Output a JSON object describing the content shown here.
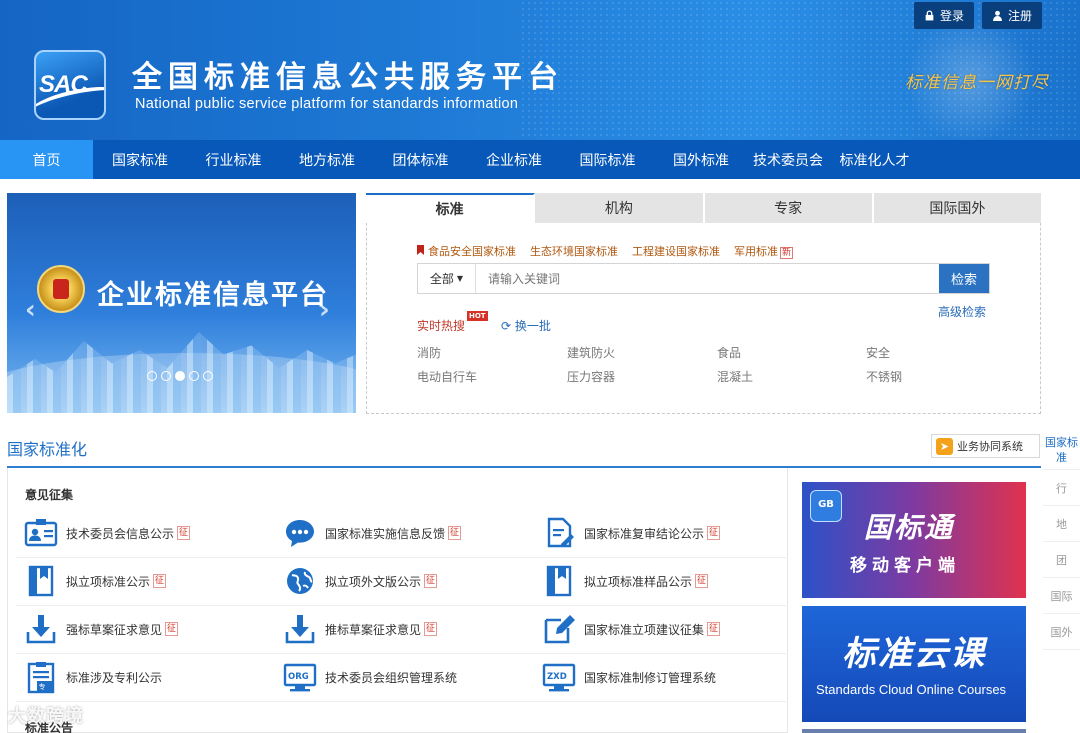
{
  "auth": {
    "login": "登录",
    "register": "注册"
  },
  "header": {
    "logo_text": "SAC",
    "title_cn": "全国标准信息公共服务平台",
    "title_en": "National public service platform  for standards information",
    "slogan": "标准信息一网打尽"
  },
  "nav": [
    "首页",
    "国家标准",
    "行业标准",
    "地方标准",
    "团体标准",
    "企业标准",
    "国际标准",
    "国外标准",
    "技术委员会",
    "标准化人才"
  ],
  "banner": {
    "title": "企业标准信息平台",
    "slides": 5,
    "active_slide": 3
  },
  "search": {
    "tabs": [
      "标准",
      "机构",
      "专家",
      "国际国外"
    ],
    "quick_links": [
      "食品安全国家标准",
      "生态环境国家标准",
      "工程建设国家标准",
      "军用标准"
    ],
    "new_badge": "新",
    "scope": "全部",
    "placeholder": "请输入关键词",
    "button": "检索",
    "advanced": "高级检索",
    "hot_label": "实时热搜",
    "hot_badge": "HOT",
    "refresh": "换一批",
    "keywords": [
      "消防",
      "建筑防火",
      "食品",
      "安全",
      "电动自行车",
      "压力容器",
      "混凝土",
      "不锈钢"
    ]
  },
  "section": {
    "title": "国家标准化",
    "coop_button": "业务协同系统",
    "sub_title": "意见征集",
    "tag": "征",
    "links": [
      {
        "label": "技术委员会信息公示",
        "tag": true,
        "icon": "id-card-icon"
      },
      {
        "label": "国家标准实施信息反馈",
        "tag": true,
        "icon": "chat-bubble-icon"
      },
      {
        "label": "国家标准复审结论公示",
        "tag": true,
        "icon": "document-edit-icon"
      },
      {
        "label": "拟立项标准公示",
        "tag": true,
        "icon": "bookmark-book-icon"
      },
      {
        "label": "拟立项外文版公示",
        "tag": true,
        "icon": "globe-icon"
      },
      {
        "label": "拟立项标准样品公示",
        "tag": true,
        "icon": "bookmark-book-icon"
      },
      {
        "label": "强标草案征求意见",
        "tag": true,
        "icon": "download-tray-icon"
      },
      {
        "label": "推标草案征求意见",
        "tag": true,
        "icon": "download-tray-icon"
      },
      {
        "label": "国家标准立项建议征集",
        "tag": true,
        "icon": "edit-pencil-icon"
      },
      {
        "label": "标准涉及专利公示",
        "tag": false,
        "icon": "patent-clipboard-icon"
      },
      {
        "label": "技术委员会组织管理系统",
        "tag": false,
        "icon": "org-monitor-icon"
      },
      {
        "label": "国家标准制修订管理系统",
        "tag": false,
        "icon": "zxd-monitor-icon"
      }
    ],
    "bottom_title": "标准公告"
  },
  "side_nav": [
    "国家标准",
    "行",
    "地",
    "团",
    "国际",
    "国外"
  ],
  "ads": {
    "app_icon_label": "GB",
    "app_name": "国标通",
    "app_sub": "移动客户端",
    "cloud_title": "标准云课",
    "cloud_sub": "Standards Cloud Online Courses"
  },
  "watermark": "大数跨境",
  "colors": {
    "primary": "#0758b8",
    "nav_active": "#2894f3",
    "accent_text": "#1e6fc5",
    "tag_red": "#d2382d"
  }
}
